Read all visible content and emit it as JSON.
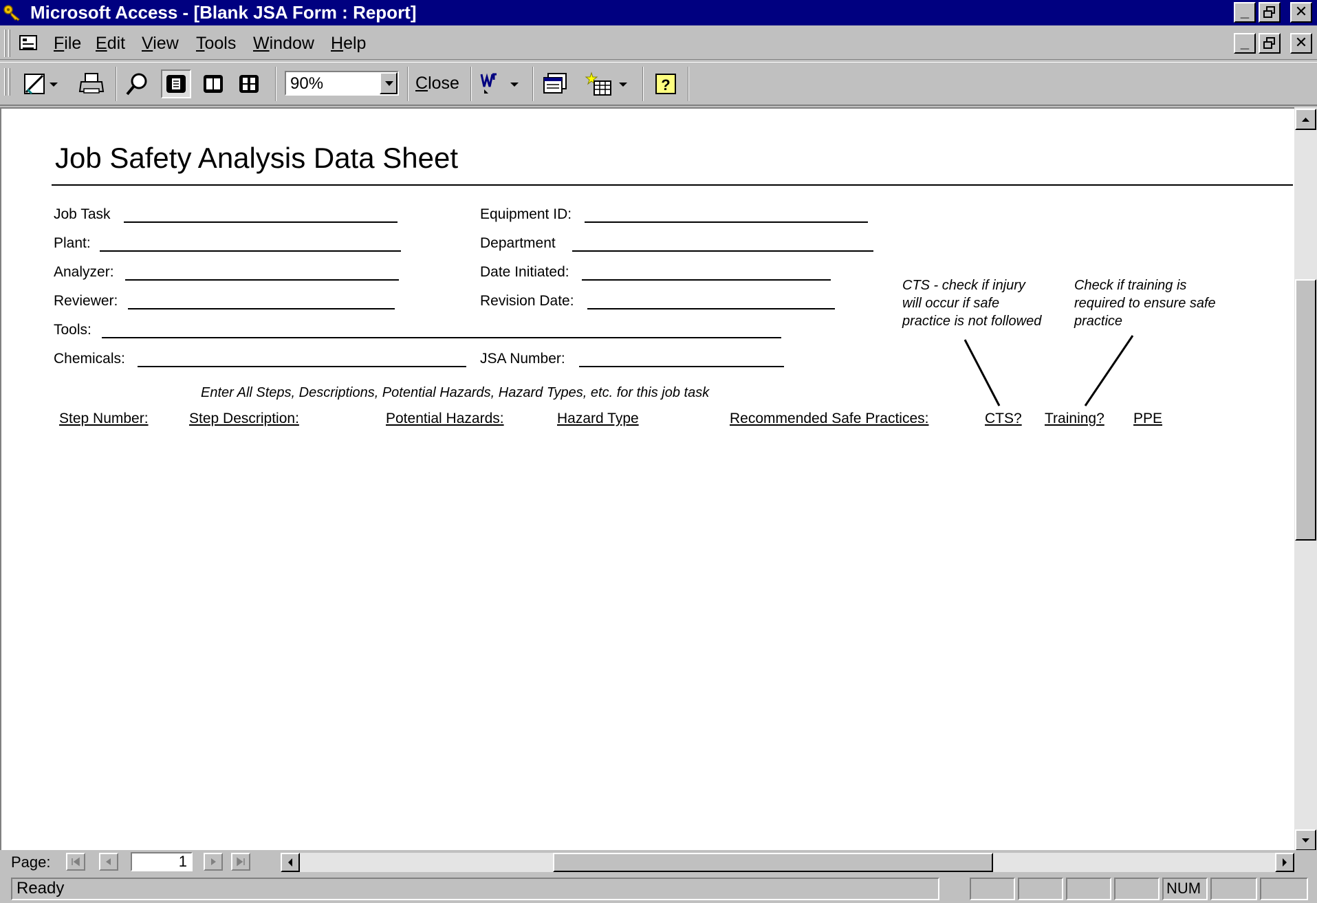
{
  "window": {
    "title": "Microsoft Access - [Blank JSA Form : Report]",
    "title_bg": "#000080"
  },
  "menu": {
    "items": [
      {
        "key": "F",
        "rest": "ile"
      },
      {
        "key": "E",
        "rest": "dit"
      },
      {
        "key": "V",
        "rest": "iew"
      },
      {
        "key": "T",
        "rest": "ools"
      },
      {
        "key": "W",
        "rest": "indow"
      },
      {
        "key": "H",
        "rest": "elp"
      }
    ]
  },
  "toolbar": {
    "zoom_value": "90%",
    "close_key": "C",
    "close_rest": "lose",
    "icons": [
      "design-view-icon",
      "print-icon",
      "zoom-icon",
      "one-page-icon",
      "two-pages-icon",
      "multiple-pages-icon",
      "office-links-icon",
      "database-window-icon",
      "new-object-icon",
      "help-icon"
    ]
  },
  "report": {
    "title": "Job Safety Analysis Data Sheet",
    "fields": {
      "job_task": "Job Task",
      "equipment_id": "Equipment ID:",
      "plant": "Plant:",
      "department": "Department",
      "analyzer": "Analyzer:",
      "date_initiated": "Date Initiated:",
      "reviewer": "Reviewer:",
      "revision_date": "Revision Date:",
      "tools": "Tools:",
      "chemicals": "Chemicals:",
      "jsa_number": "JSA Number:"
    },
    "notes": {
      "cts": [
        "CTS - check if injury",
        "will occur if safe",
        "practice is not followed"
      ],
      "training": [
        "Check if training is",
        "required to ensure safe",
        "practice"
      ],
      "instruction": "Enter All Steps, Descriptions, Potential Hazards, Hazard Types, etc. for this job task"
    },
    "columns": [
      "Step Number:",
      "Step Description:",
      "Potential Hazards:",
      "Hazard Type",
      "Recommended Safe Practices:",
      "CTS?",
      "Training?",
      "PPE"
    ]
  },
  "navigation": {
    "page_label": "Page:",
    "page_number": "1"
  },
  "status": {
    "text": "Ready",
    "num": "NUM"
  }
}
